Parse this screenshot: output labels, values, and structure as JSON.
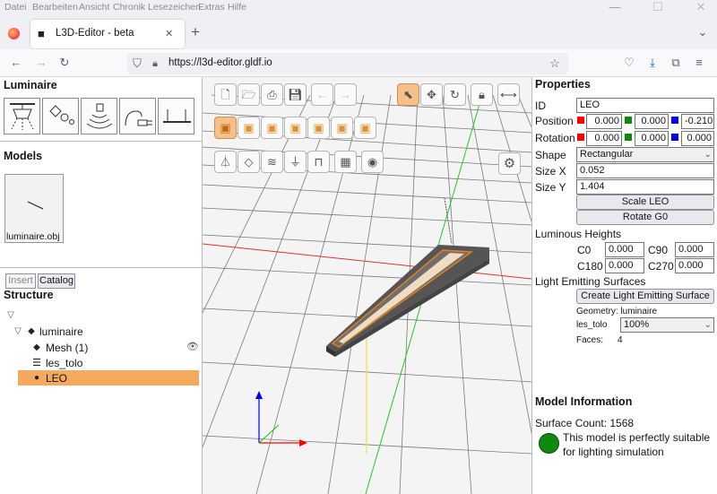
{
  "browser": {
    "menu": [
      "Datei",
      "Bearbeiten",
      "Ansicht",
      "Chronik",
      "Lesezeichen",
      "Extras",
      "Hilfe"
    ],
    "tab_title": "L3D-Editor - beta",
    "url": "https://l3d-editor.gldf.io"
  },
  "left": {
    "luminaire_heading": "Luminaire",
    "luminaire_buttons": [
      "pendant-luminaire",
      "sensor",
      "emitter",
      "connector",
      "mounting"
    ],
    "models_heading": "Models",
    "model_file": "luminaire.obj",
    "tabs": {
      "insert": "Insert",
      "catalog": "Catalog"
    },
    "structure_heading": "Structure",
    "tree": {
      "root": "luminaire",
      "mesh": "Mesh (1)",
      "group": "les_tolo",
      "selected": "LEO"
    }
  },
  "viewport": {
    "axis_colors": {
      "x": "#ff0000",
      "y": "#00cc00",
      "z": "#0000ff"
    }
  },
  "properties": {
    "heading": "Properties",
    "id_label": "ID",
    "id": "LEO",
    "position_label": "Position",
    "position": [
      "0.000",
      "0.000",
      "-0.210"
    ],
    "rotation_label": "Rotation",
    "rotation": [
      "0.000",
      "0.000",
      "0.000"
    ],
    "shape_label": "Shape",
    "shape": "Rectangular",
    "sizex_label": "Size X",
    "sizex": "0.052",
    "sizey_label": "Size Y",
    "sizey": "1.404",
    "scale_btn": "Scale LEO",
    "rotate_btn": "Rotate G0",
    "lum_heights_label": "Luminous Heights",
    "c0_label": "C0",
    "c0": "0.000",
    "c90_label": "C90",
    "c90": "0.000",
    "c180_label": "C180",
    "c180": "0.000",
    "c270_label": "C270",
    "c270": "0.000",
    "les_label": "Light Emitting Surfaces",
    "create_les_btn": "Create Light Emitting Surface",
    "geometry_text": "Geometry: luminaire",
    "les_name": "les_tolo",
    "les_value": "100%",
    "faces_label": "Faces:",
    "faces": "4"
  },
  "model_info": {
    "heading": "Model Information",
    "surface_count": "Surface Count: 1568",
    "status_line1": "This model is perfectly suitable",
    "status_line2": "for lighting simulation",
    "status_color": "#0f8a0f"
  }
}
